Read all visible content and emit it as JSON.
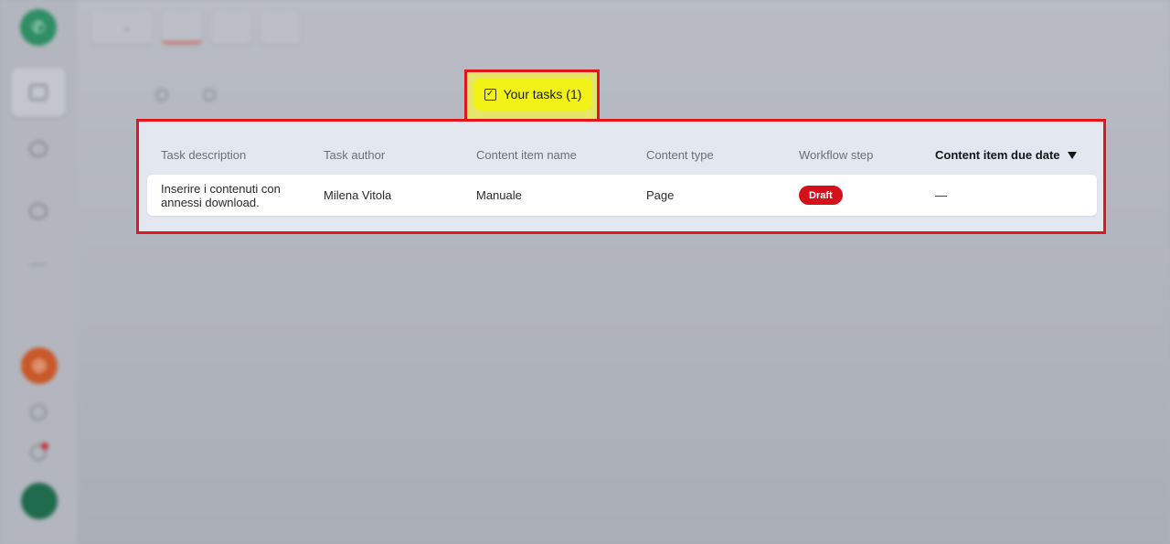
{
  "app": {
    "logo_glyph": "✆",
    "accent": "#f2f218",
    "highlight_border": "#e3161d"
  },
  "sidebar": {
    "items": [
      {
        "label": "",
        "icon": "home-icon",
        "active": true
      },
      {
        "label": "",
        "icon": "globe-icon",
        "active": false
      },
      {
        "label": "",
        "icon": "globe-icon",
        "active": false
      },
      {
        "label": "",
        "icon": "grid-icon",
        "active": false
      }
    ],
    "fab_icon": "add-icon",
    "avatar_initials": ""
  },
  "topbar": {
    "project_selector": "",
    "tabs": [
      "",
      "",
      ""
    ]
  },
  "subtabs": {
    "items": [
      "",
      ""
    ],
    "active_label": "Your tasks (1)"
  },
  "table": {
    "headers": {
      "task_description": "Task description",
      "task_author": "Task author",
      "content_item_name": "Content item name",
      "content_type": "Content type",
      "workflow_step": "Workflow step",
      "due_date": "Content item due date"
    },
    "rows": [
      {
        "task_description": "Inserire i contenuti con annessi download.",
        "task_author": "Milena Vitola",
        "content_item_name": "Manuale",
        "content_type": "Page",
        "workflow_step": "Draft",
        "due_date": "—"
      }
    ],
    "badge_color": "#d4101a"
  }
}
